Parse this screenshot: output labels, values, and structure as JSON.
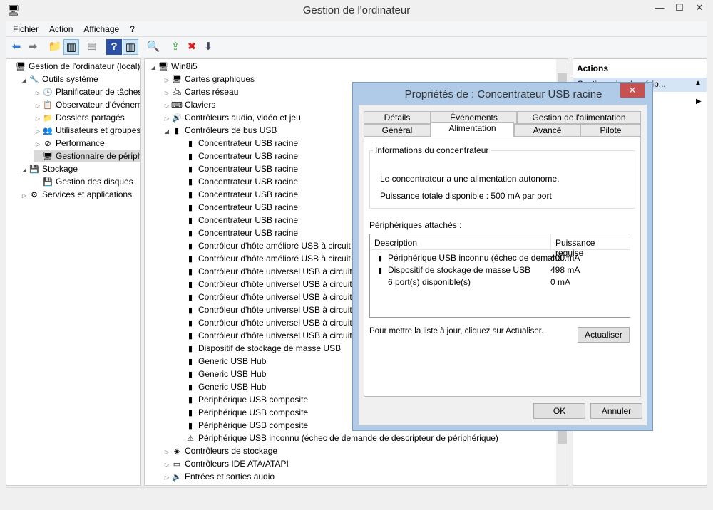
{
  "window": {
    "title": "Gestion de l'ordinateur",
    "minimize": "—",
    "maximize": "☐",
    "close": "✕"
  },
  "menu": [
    "Fichier",
    "Action",
    "Affichage",
    "?"
  ],
  "tree": [
    {
      "label": "Gestion de l'ordinateur (local)",
      "icon": "🖥",
      "level": 0,
      "tw": ""
    },
    {
      "label": "Outils système",
      "icon": "🔧",
      "level": 1,
      "tw": "◢"
    },
    {
      "label": "Planificateur de tâches",
      "icon": "🕒",
      "level": 2,
      "tw": "▷"
    },
    {
      "label": "Observateur d'événeme",
      "icon": "📋",
      "level": 2,
      "tw": "▷"
    },
    {
      "label": "Dossiers partagés",
      "icon": "📁",
      "level": 2,
      "tw": "▷"
    },
    {
      "label": "Utilisateurs et groupes l",
      "icon": "👥",
      "level": 2,
      "tw": "▷"
    },
    {
      "label": "Performance",
      "icon": "⊘",
      "level": 2,
      "tw": "▷"
    },
    {
      "label": "Gestionnaire de périphé",
      "icon": "🖥",
      "level": 2,
      "tw": "",
      "selected": true
    },
    {
      "label": "Stockage",
      "icon": "💾",
      "level": 1,
      "tw": "◢"
    },
    {
      "label": "Gestion des disques",
      "icon": "💾",
      "level": 2,
      "tw": ""
    },
    {
      "label": "Services et applications",
      "icon": "⚙",
      "level": 1,
      "tw": "▷"
    }
  ],
  "devices": [
    {
      "label": "Win8i5",
      "icon": "🖥",
      "level": 0,
      "tw": "◢"
    },
    {
      "label": "Cartes graphiques",
      "icon": "🖥",
      "level": 1,
      "tw": "▷"
    },
    {
      "label": "Cartes réseau",
      "icon": "🖧",
      "level": 1,
      "tw": "▷"
    },
    {
      "label": "Claviers",
      "icon": "⌨",
      "level": 1,
      "tw": "▷"
    },
    {
      "label": "Contrôleurs audio, vidéo et jeu",
      "icon": "🔊",
      "level": 1,
      "tw": "▷"
    },
    {
      "label": "Contrôleurs de bus USB",
      "icon": "▮",
      "level": 1,
      "tw": "◢"
    },
    {
      "label": "Concentrateur USB racine",
      "icon": "▮",
      "level": 2
    },
    {
      "label": "Concentrateur USB racine",
      "icon": "▮",
      "level": 2
    },
    {
      "label": "Concentrateur USB racine",
      "icon": "▮",
      "level": 2
    },
    {
      "label": "Concentrateur USB racine",
      "icon": "▮",
      "level": 2
    },
    {
      "label": "Concentrateur USB racine",
      "icon": "▮",
      "level": 2
    },
    {
      "label": "Concentrateur USB racine",
      "icon": "▮",
      "level": 2
    },
    {
      "label": "Concentrateur USB racine",
      "icon": "▮",
      "level": 2
    },
    {
      "label": "Concentrateur USB racine",
      "icon": "▮",
      "level": 2
    },
    {
      "label": "Contrôleur d'hôte amélioré USB à circuit",
      "icon": "▮",
      "level": 2
    },
    {
      "label": "Contrôleur d'hôte amélioré USB à circuit",
      "icon": "▮",
      "level": 2
    },
    {
      "label": "Contrôleur d'hôte universel USB à circuit",
      "icon": "▮",
      "level": 2
    },
    {
      "label": "Contrôleur d'hôte universel USB à circuit",
      "icon": "▮",
      "level": 2
    },
    {
      "label": "Contrôleur d'hôte universel USB à circuit",
      "icon": "▮",
      "level": 2
    },
    {
      "label": "Contrôleur d'hôte universel USB à circuit",
      "icon": "▮",
      "level": 2
    },
    {
      "label": "Contrôleur d'hôte universel USB à circuit",
      "icon": "▮",
      "level": 2
    },
    {
      "label": "Contrôleur d'hôte universel USB à circuit",
      "icon": "▮",
      "level": 2
    },
    {
      "label": "Dispositif de stockage de masse USB",
      "icon": "▮",
      "level": 2
    },
    {
      "label": "Generic USB Hub",
      "icon": "▮",
      "level": 2
    },
    {
      "label": "Generic USB Hub",
      "icon": "▮",
      "level": 2
    },
    {
      "label": "Generic USB Hub",
      "icon": "▮",
      "level": 2
    },
    {
      "label": "Périphérique USB composite",
      "icon": "▮",
      "level": 2
    },
    {
      "label": "Périphérique USB composite",
      "icon": "▮",
      "level": 2
    },
    {
      "label": "Périphérique USB composite",
      "icon": "▮",
      "level": 2
    },
    {
      "label": "Périphérique USB inconnu (échec de demande de descripteur de périphérique)",
      "icon": "⚠",
      "level": 2
    },
    {
      "label": "Contrôleurs de stockage",
      "icon": "◈",
      "level": 1,
      "tw": "▷"
    },
    {
      "label": "Contrôleurs IDE ATA/ATAPI",
      "icon": "▭",
      "level": 1,
      "tw": "▷"
    },
    {
      "label": "Entrées et sorties audio",
      "icon": "🔈",
      "level": 1,
      "tw": "▷"
    }
  ],
  "actions": {
    "header": "Actions",
    "item": "Gestionnaire de périp..."
  },
  "dialog": {
    "title": "Propriétés de : Concentrateur USB racine",
    "tabs_back": [
      "Détails",
      "Événements",
      "Gestion de l'alimentation"
    ],
    "tabs_front": [
      "Général",
      "Alimentation",
      "Avancé",
      "Pilote"
    ],
    "group_title": "Informations du concentrateur",
    "info1": "Le concentrateur a une alimentation autonome.",
    "info2": "Puissance totale disponible : 500 mA par port",
    "attached_label": "Périphériques attachés :",
    "columns": [
      "Description",
      "Puissance requise"
    ],
    "rows": [
      {
        "icon": "▮",
        "desc": "Périphérique USB inconnu (échec de demand...",
        "power": "400 mA"
      },
      {
        "icon": "▮",
        "desc": "Dispositif de stockage de masse USB",
        "power": "498 mA"
      },
      {
        "icon": "",
        "desc": "6 port(s) disponible(s)",
        "power": "0 mA"
      }
    ],
    "refresh_hint": "Pour mettre la liste à jour, cliquez sur Actualiser.",
    "refresh": "Actualiser",
    "ok": "OK",
    "cancel": "Annuler"
  }
}
